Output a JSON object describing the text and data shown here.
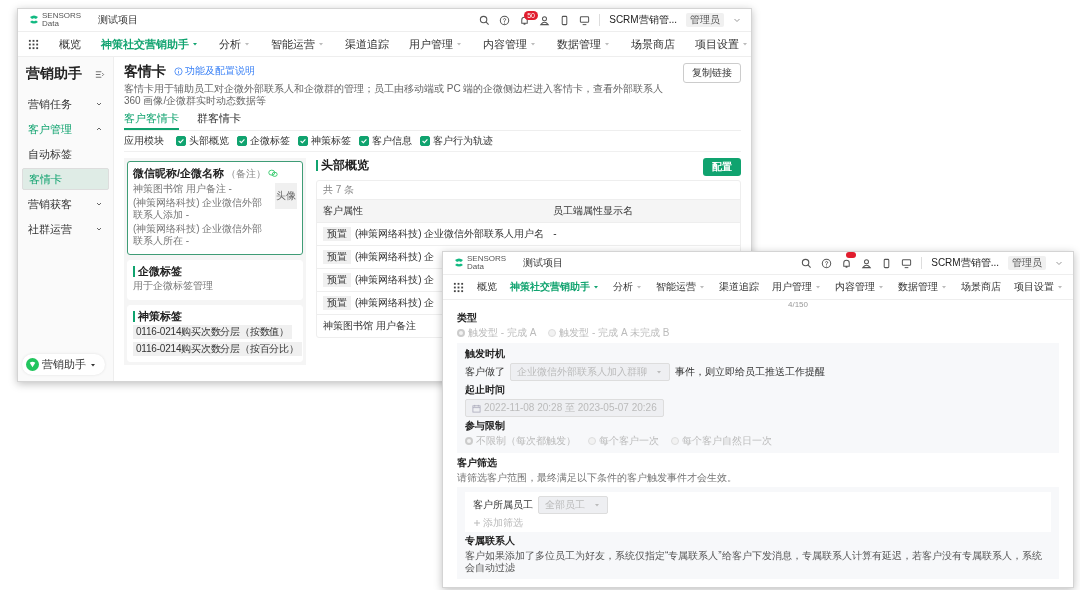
{
  "back_window": {
    "header": {
      "logo": [
        "SENSORS",
        "Data"
      ],
      "project": "测试项目",
      "badge": "50",
      "account": "SCRM营销管...",
      "role": "管理员"
    },
    "nav": [
      {
        "label": "概览",
        "selected": false,
        "dropdown": false
      },
      {
        "label": "神策社交营销助手",
        "selected": true,
        "dropdown": true
      },
      {
        "label": "分析",
        "selected": false,
        "dropdown": true
      },
      {
        "label": "智能运营",
        "selected": false,
        "dropdown": true
      },
      {
        "label": "渠道追踪",
        "selected": false,
        "dropdown": false
      },
      {
        "label": "用户管理",
        "selected": false,
        "dropdown": true
      },
      {
        "label": "内容管理",
        "selected": false,
        "dropdown": true
      },
      {
        "label": "数据管理",
        "selected": false,
        "dropdown": true
      },
      {
        "label": "场景商店",
        "selected": false,
        "dropdown": false
      },
      {
        "label": "项目设置",
        "selected": false,
        "dropdown": true
      }
    ],
    "sidebar": {
      "title": "营销助手",
      "items": [
        {
          "label": "营销任务",
          "selected": false,
          "expanded": false
        },
        {
          "label": "客户管理",
          "selected": false,
          "expanded": true,
          "children": [
            {
              "label": "自动标签",
              "selected": false
            },
            {
              "label": "客情卡",
              "selected": true
            }
          ]
        },
        {
          "label": "营销获客",
          "selected": false,
          "expanded": false
        },
        {
          "label": "社群运营",
          "selected": false,
          "expanded": false
        }
      ],
      "footer": "营销助手"
    },
    "page": {
      "title": "客情卡",
      "help_link": "功能及配置说明",
      "description": "客情卡用于辅助员工对企微外部联系人和企微群的管理；员工由移动端或 PC 端的企微侧边栏进入客情卡，查看外部联系人 360 画像/企微群实时动态数据等",
      "copy_button": "复制链接",
      "tabs": [
        {
          "label": "客户客情卡",
          "selected": true
        },
        {
          "label": "群客情卡",
          "selected": false
        }
      ],
      "modules": {
        "label": "应用模块",
        "items": [
          {
            "label": "头部概览",
            "checked": true
          },
          {
            "label": "企微标签",
            "checked": true
          },
          {
            "label": "神策标签",
            "checked": true
          },
          {
            "label": "客户信息",
            "checked": true
          },
          {
            "label": "客户行为轨迹",
            "checked": true
          }
        ]
      },
      "cards": [
        {
          "kind": "profile",
          "selected": true,
          "title": "微信昵称/企微名称",
          "note": "（备注）",
          "avatar": "头像",
          "lines": [
            "神策图书馆 用户备注 -",
            "(神策网络科技) 企业微信外部联系人添加 -",
            "(神策网络科技) 企业微信外部联系人所在 -"
          ]
        },
        {
          "kind": "text",
          "selected": false,
          "title": "企微标签",
          "text": "用于企微标签管理"
        },
        {
          "kind": "tags",
          "selected": false,
          "title": "神策标签",
          "tags": [
            "0116-0214购买次数分层（按数值）",
            "0116-0214购买次数分层（按百分比）"
          ]
        }
      ],
      "overview": {
        "title": "头部概览",
        "button": "配置",
        "count": "共 7 条",
        "columns": [
          "客户属性",
          "员工端属性显示名"
        ],
        "rows": [
          {
            "tag": "预置",
            "cells": [
              "(神策网络科技) 企业微信外部联系人用户名",
              "-"
            ]
          },
          {
            "tag": "预置",
            "cells": [
              "(神策网络科技) 企"
            ]
          },
          {
            "tag": "预置",
            "cells": [
              "(神策网络科技) 企"
            ]
          },
          {
            "tag": "预置",
            "cells": [
              "(神策网络科技) 企"
            ]
          },
          {
            "cells": [
              "神策图书馆 用户备注"
            ]
          }
        ]
      }
    }
  },
  "front_window": {
    "header": {
      "logo": [
        "SENSORS",
        "Data"
      ],
      "project": "测试项目",
      "account": "SCRM营销管...",
      "role": "管理员"
    },
    "nav": [
      {
        "label": "概览",
        "selected": false,
        "dropdown": false
      },
      {
        "label": "神策社交营销助手",
        "selected": true,
        "dropdown": true
      },
      {
        "label": "分析",
        "selected": false,
        "dropdown": true
      },
      {
        "label": "智能运营",
        "selected": false,
        "dropdown": true
      },
      {
        "label": "渠道追踪",
        "selected": false,
        "dropdown": false
      },
      {
        "label": "用户管理",
        "selected": false,
        "dropdown": true
      },
      {
        "label": "内容管理",
        "selected": false,
        "dropdown": true
      },
      {
        "label": "数据管理",
        "selected": false,
        "dropdown": true
      },
      {
        "label": "场景商店",
        "selected": false,
        "dropdown": false
      },
      {
        "label": "项目设置",
        "selected": false,
        "dropdown": true
      }
    ],
    "form": {
      "disabled": true,
      "counter": "4/150",
      "type": {
        "label": "类型",
        "options": [
          {
            "label": "触发型 - 完成 A",
            "selected": true
          },
          {
            "label": "触发型 - 完成 A 未完成 B",
            "selected": false
          }
        ]
      },
      "trigger": {
        "label": "触发时机",
        "prefix": "客户做了",
        "select": "企业微信外部联系人加入群聊",
        "suffix": "事件，则立即给员工推送工作提醒"
      },
      "period": {
        "label": "起止时间",
        "value": "2022-11-08 20:28 至 2023-05-07 20:26"
      },
      "limit": {
        "label": "参与限制",
        "options": [
          {
            "label": "不限制（每次都触发）",
            "selected": true
          },
          {
            "label": "每个客户一次",
            "selected": false
          },
          {
            "label": "每个客户自然日一次",
            "selected": false
          }
        ]
      },
      "filter": {
        "label": "客户筛选",
        "hint": "请筛选客户范围，最终满足以下条件的客户触发事件才会生效。",
        "field_label": "客户所属员工",
        "select": "全部员工",
        "add": "添加筛选"
      },
      "contact": {
        "label": "专属联系人",
        "text": "客户如果添加了多位员工为好友，系统仅指定“专属联系人”给客户下发消息，专属联系人计算有延迟，若客户没有专属联系人，系统会自动过滤"
      }
    }
  }
}
